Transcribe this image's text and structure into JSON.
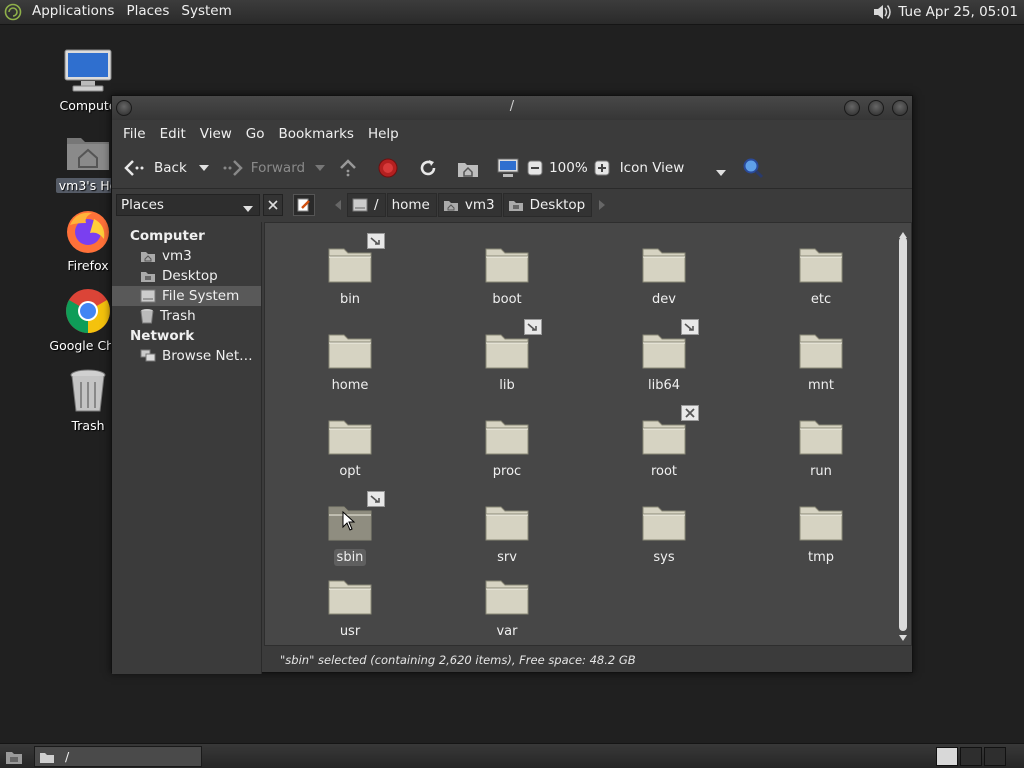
{
  "top_panel": {
    "menus": [
      "Applications",
      "Places",
      "System"
    ],
    "clock": "Tue Apr 25, 05:01"
  },
  "desktop": {
    "icons": [
      {
        "label": "Compute",
        "icon": "computer-icon"
      },
      {
        "label": "vm3's Ho",
        "icon": "home-folder-icon"
      },
      {
        "label": "Firefox",
        "icon": "firefox-icon"
      },
      {
        "label": "Google Chro",
        "icon": "chrome-icon"
      },
      {
        "label": "Trash",
        "icon": "trash-icon"
      }
    ]
  },
  "window": {
    "title": "/",
    "menu": [
      "File",
      "Edit",
      "View",
      "Go",
      "Bookmarks",
      "Help"
    ],
    "toolbar": {
      "back": "Back",
      "forward": "Forward",
      "zoom": "100%",
      "view_mode": "Icon View"
    },
    "places_combo": "Places",
    "breadcrumbs": [
      "/",
      "home",
      "vm3",
      "Desktop"
    ],
    "sidebar": {
      "computer_heading": "Computer",
      "computer_items": [
        "vm3",
        "Desktop",
        "File System",
        "Trash"
      ],
      "network_heading": "Network",
      "network_items": [
        "Browse Net…"
      ]
    },
    "folders": [
      {
        "name": "bin",
        "emblem": "symlink"
      },
      {
        "name": "boot",
        "emblem": ""
      },
      {
        "name": "dev",
        "emblem": ""
      },
      {
        "name": "etc",
        "emblem": ""
      },
      {
        "name": "home",
        "emblem": ""
      },
      {
        "name": "lib",
        "emblem": "symlink"
      },
      {
        "name": "lib64",
        "emblem": "symlink"
      },
      {
        "name": "mnt",
        "emblem": ""
      },
      {
        "name": "opt",
        "emblem": ""
      },
      {
        "name": "proc",
        "emblem": ""
      },
      {
        "name": "root",
        "emblem": "locked"
      },
      {
        "name": "run",
        "emblem": ""
      },
      {
        "name": "sbin",
        "emblem": "symlink"
      },
      {
        "name": "srv",
        "emblem": ""
      },
      {
        "name": "sys",
        "emblem": ""
      },
      {
        "name": "tmp",
        "emblem": ""
      },
      {
        "name": "usr",
        "emblem": ""
      },
      {
        "name": "var",
        "emblem": ""
      }
    ],
    "status": "\"sbin\" selected (containing 2,620 items), Free space: 48.2 GB"
  },
  "bottom_panel": {
    "task_title": "/"
  },
  "colors": {
    "desktop_bg": "#202020",
    "window_bg": "#3b3b3b",
    "content_bg": "#474747",
    "folder": "#d6d3c2"
  }
}
